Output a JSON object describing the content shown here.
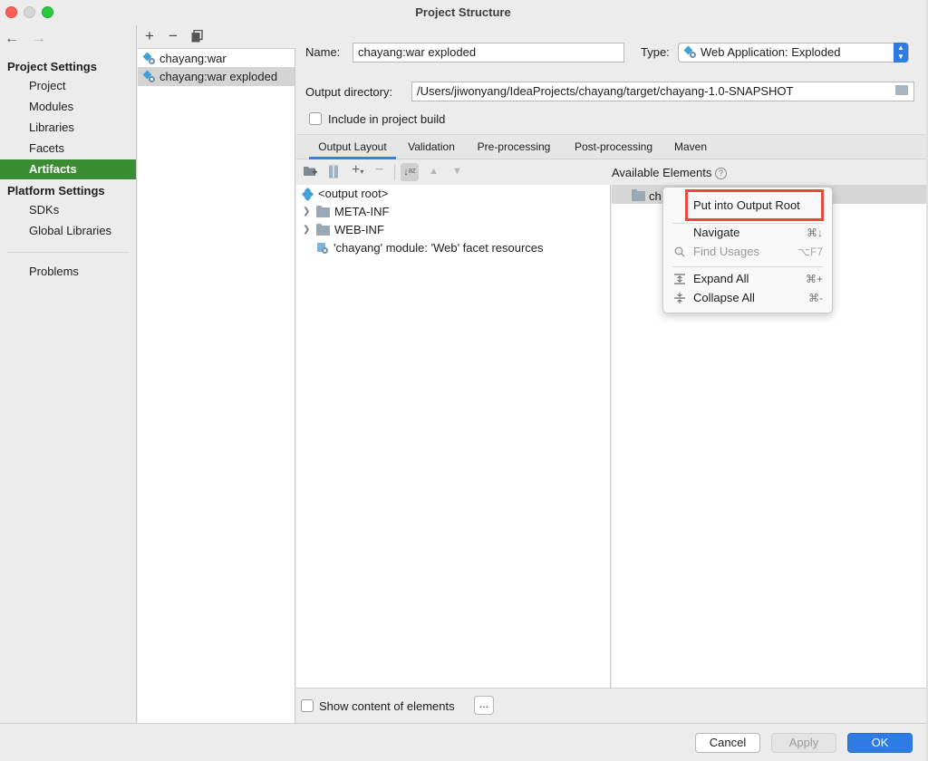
{
  "window": {
    "title": "Project Structure"
  },
  "nav": {
    "back_icon": "arrow-left-icon",
    "forward_icon": "arrow-right-icon",
    "project_settings_header": "Project Settings",
    "project_settings": [
      "Project",
      "Modules",
      "Libraries",
      "Facets",
      "Artifacts"
    ],
    "platform_settings_header": "Platform Settings",
    "platform_settings": [
      "SDKs",
      "Global Libraries"
    ],
    "problems": "Problems",
    "selected": "Artifacts",
    "accent_color": "#3b8d33"
  },
  "artifacts": {
    "toolbar": {
      "add": "+",
      "remove": "−",
      "copy_icon": "copy-icon"
    },
    "items": [
      "chayang:war",
      "chayang:war exploded"
    ],
    "selected": "chayang:war exploded"
  },
  "form": {
    "name_label": "Name:",
    "name_value": "chayang:war exploded",
    "type_label": "Type:",
    "type_value": "Web Application: Exploded",
    "output_dir_label": "Output directory:",
    "output_dir_value": "/Users/jiwonyang/IdeaProjects/chayang/target/chayang-1.0-SNAPSHOT",
    "include_build_label": "Include in project build",
    "include_build_checked": false
  },
  "tabs": [
    "Output Layout",
    "Validation",
    "Pre-processing",
    "Post-processing",
    "Maven"
  ],
  "active_tab": "Output Layout",
  "layout_tree": {
    "root": "<output root>",
    "children": [
      "META-INF",
      "WEB-INF",
      "'chayang' module: 'Web' facet resources"
    ]
  },
  "available": {
    "header": "Available Elements",
    "help": "?",
    "row_text": "ch"
  },
  "context_menu": {
    "items": [
      {
        "label": "Put into Output Root",
        "shortcut": ""
      },
      {
        "label": "Navigate",
        "shortcut": "⌘↓"
      },
      {
        "label": "Find Usages",
        "shortcut": "⌥F7",
        "disabled": true
      },
      {
        "label": "Expand All",
        "shortcut": "⌘+"
      },
      {
        "label": "Collapse All",
        "shortcut": "⌘-"
      }
    ],
    "highlight_color": "#e8483f"
  },
  "bottom": {
    "show_content_label": "Show content of elements",
    "more_button": "..."
  },
  "footer": {
    "cancel": "Cancel",
    "apply": "Apply",
    "ok": "OK",
    "primary_color": "#2f7be4"
  }
}
